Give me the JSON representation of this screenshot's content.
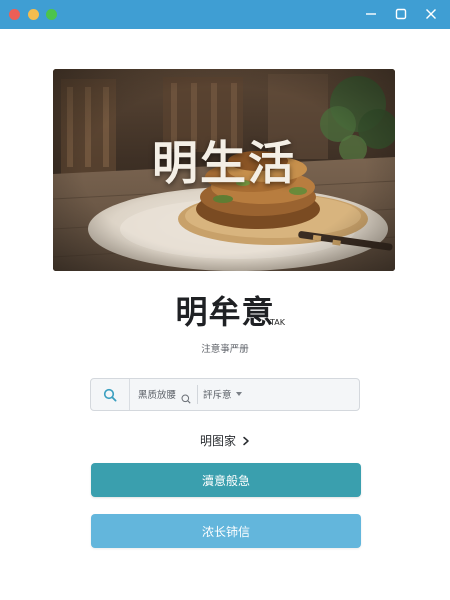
{
  "window": {
    "titlebar_color": "#3f9ed3"
  },
  "hero": {
    "title": "明生活",
    "image": "food-photo"
  },
  "brand": {
    "name": "明牟意",
    "sup": "TAK",
    "subtitle": "注意亊严册"
  },
  "search": {
    "icon": "search-icon",
    "input_value": "黑质放腰",
    "select_value": "評斥意"
  },
  "link": {
    "label": "明图家",
    "icon": "chevron-right-icon"
  },
  "buttons": {
    "primary_label": "瀆意般急",
    "secondary_label": "浓长铈信",
    "primary_color": "#3a9fae",
    "secondary_color": "#63b6dc"
  }
}
